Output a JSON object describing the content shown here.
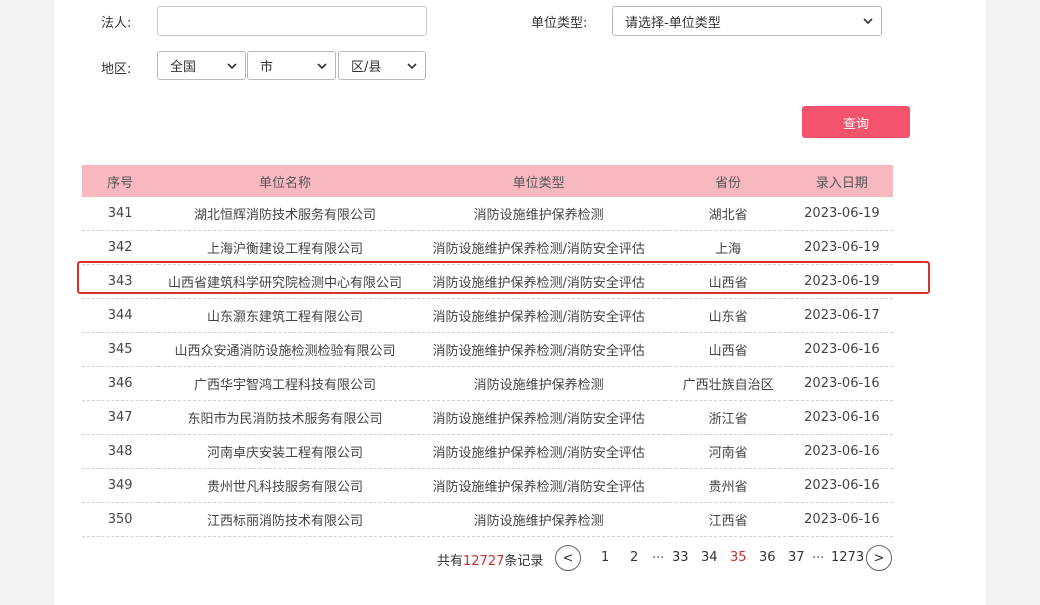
{
  "filters": {
    "legal_person_label": "法人:",
    "legal_person_value": "",
    "unit_type_label": "单位类型:",
    "unit_type_value": "请选择-单位类型",
    "region_label": "地区:",
    "province": "全国",
    "city": "市",
    "district": "区/县",
    "query_button": "查询"
  },
  "table": {
    "headers": [
      "序号",
      "单位名称",
      "单位类型",
      "省份",
      "录入日期"
    ],
    "rows": [
      [
        "341",
        "湖北恒辉消防技术服务有限公司",
        "消防设施维护保养检测",
        "湖北省",
        "2023-06-19"
      ],
      [
        "342",
        "上海沪衡建设工程有限公司",
        "消防设施维护保养检测/消防安全评估",
        "上海",
        "2023-06-19"
      ],
      [
        "343",
        "山西省建筑科学研究院检测中心有限公司",
        "消防设施维护保养检测/消防安全评估",
        "山西省",
        "2023-06-19"
      ],
      [
        "344",
        "山东灏东建筑工程有限公司",
        "消防设施维护保养检测/消防安全评估",
        "山东省",
        "2023-06-17"
      ],
      [
        "345",
        "山西众安通消防设施检测检验有限公司",
        "消防设施维护保养检测/消防安全评估",
        "山西省",
        "2023-06-16"
      ],
      [
        "346",
        "广西华宇智鸿工程科技有限公司",
        "消防设施维护保养检测",
        "广西壮族自治区",
        "2023-06-16"
      ],
      [
        "347",
        "东阳市为民消防技术服务有限公司",
        "消防设施维护保养检测/消防安全评估",
        "浙江省",
        "2023-06-16"
      ],
      [
        "348",
        "河南卓庆安装工程有限公司",
        "消防设施维护保养检测/消防安全评估",
        "河南省",
        "2023-06-16"
      ],
      [
        "349",
        "贵州世凡科技服务有限公司",
        "消防设施维护保养检测/消防安全评估",
        "贵州省",
        "2023-06-16"
      ],
      [
        "350",
        "江西标丽消防技术有限公司",
        "消防设施维护保养检测",
        "江西省",
        "2023-06-16"
      ]
    ]
  },
  "pagination": {
    "total_prefix": "共有",
    "total_count": "12727",
    "total_suffix": "条记录",
    "prev": "<",
    "next": ">",
    "ellipsis": "...",
    "pages": [
      "1",
      "2",
      "33",
      "34",
      "35",
      "36",
      "37",
      "1273"
    ],
    "current": "35"
  },
  "colors": {
    "header_bg": "#f8b8c0",
    "button_bg": "#f4536e",
    "highlight_border": "#d9302c",
    "active_page": "#c9302c"
  }
}
